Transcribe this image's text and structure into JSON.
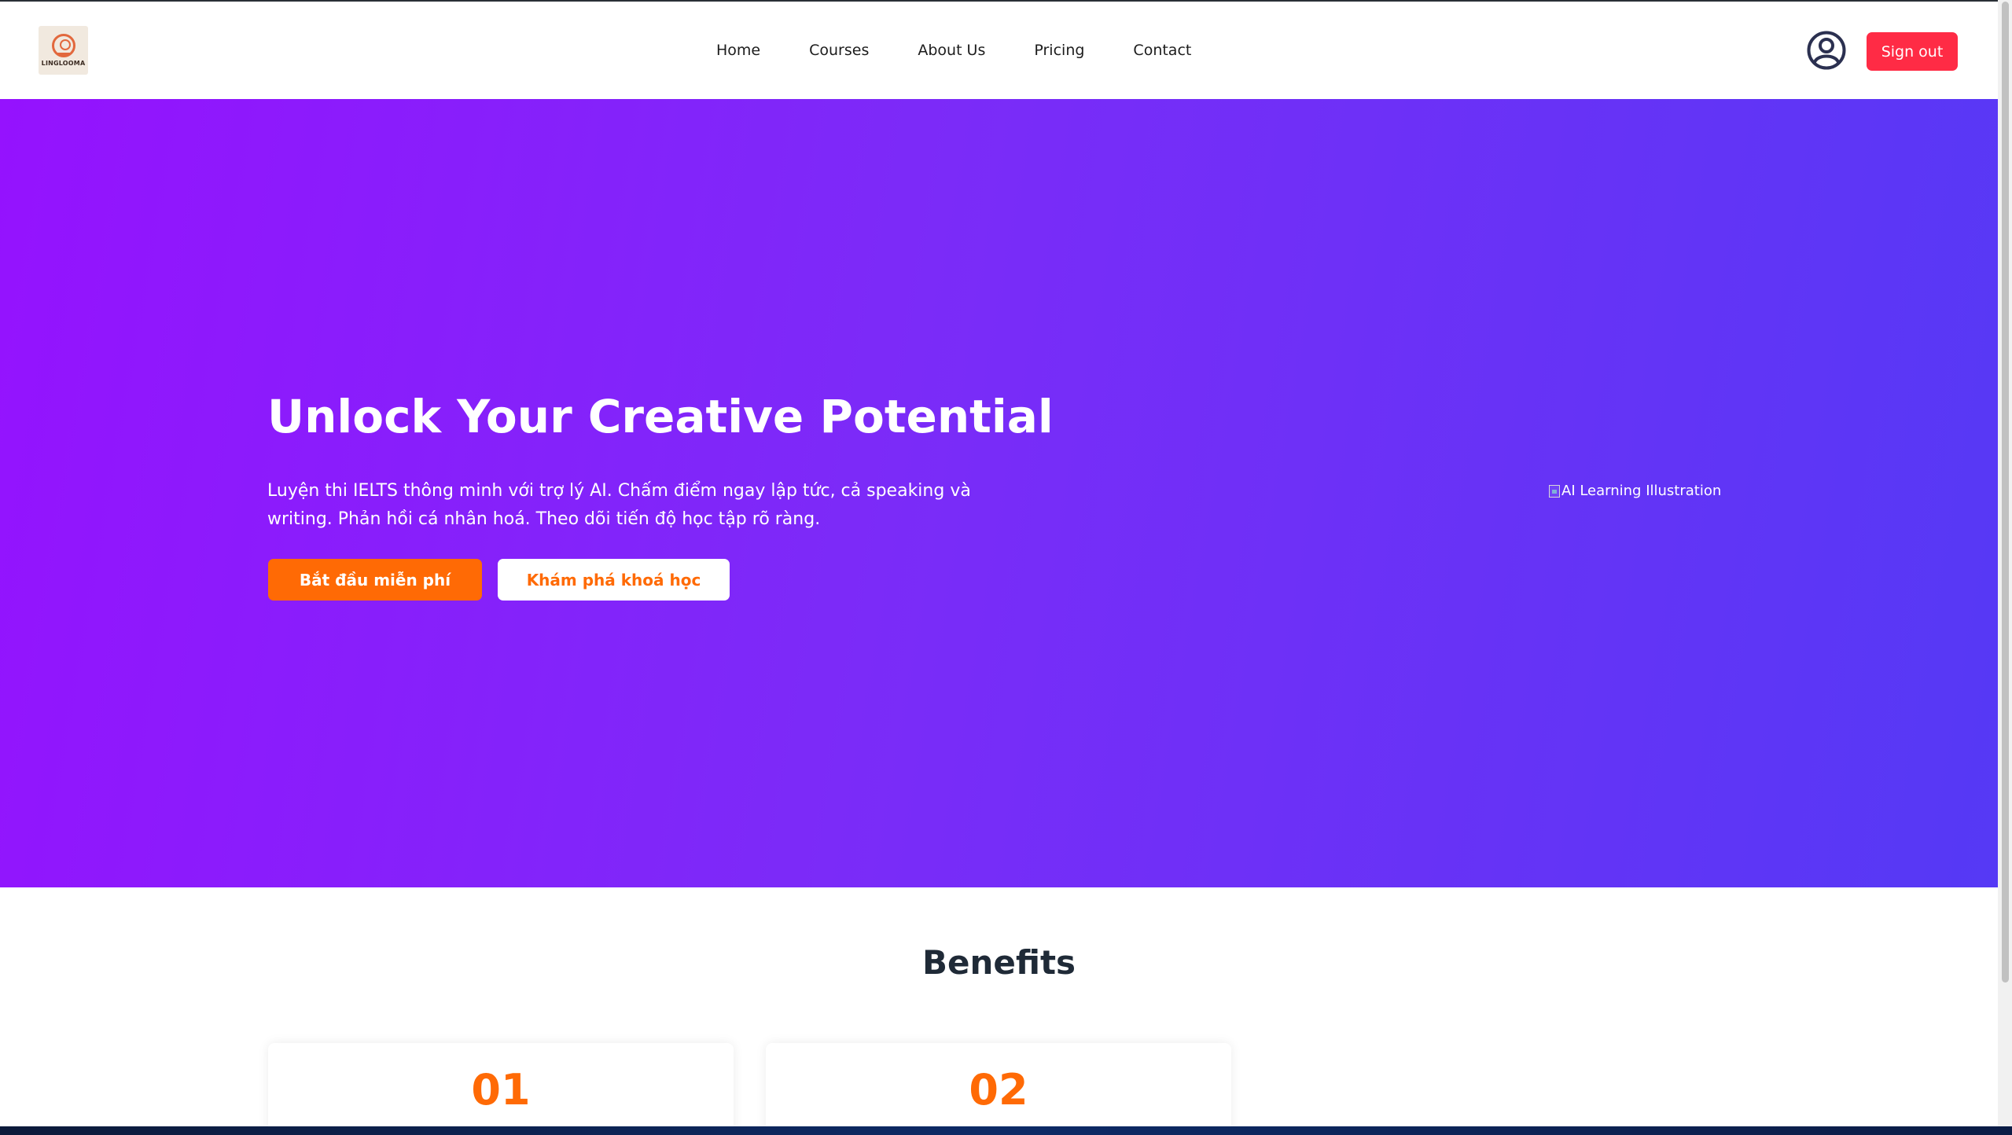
{
  "nav": {
    "logo_text": "LINGLOOMA",
    "links": [
      {
        "label": "Home"
      },
      {
        "label": "Courses"
      },
      {
        "label": "About Us"
      },
      {
        "label": "Pricing"
      },
      {
        "label": "Contact"
      }
    ],
    "signout_label": "Sign out"
  },
  "hero": {
    "title": "Unlock Your Creative Potential",
    "description": "Luyện thi IELTS thông minh với trợ lý AI. Chấm điểm ngay lập tức, cả speaking và writing. Phản hồi cá nhân hoá. Theo dõi tiến độ học tập rõ ràng.",
    "primary_cta": "Bắt đầu miễn phí",
    "secondary_cta": "Khám phá khoá học",
    "image_alt": "AI Learning Illustration"
  },
  "benefits": {
    "title": "Benefits",
    "cards": [
      {
        "number": "01"
      },
      {
        "number": "02"
      }
    ]
  },
  "colors": {
    "accent_orange": "#ff6a05",
    "signout_red": "#ff2b45",
    "gradient_start": "#9512fe",
    "gradient_end": "#5539f5"
  },
  "icons": {
    "avatar": "user-circle-icon",
    "broken_image": "broken-image-icon"
  }
}
